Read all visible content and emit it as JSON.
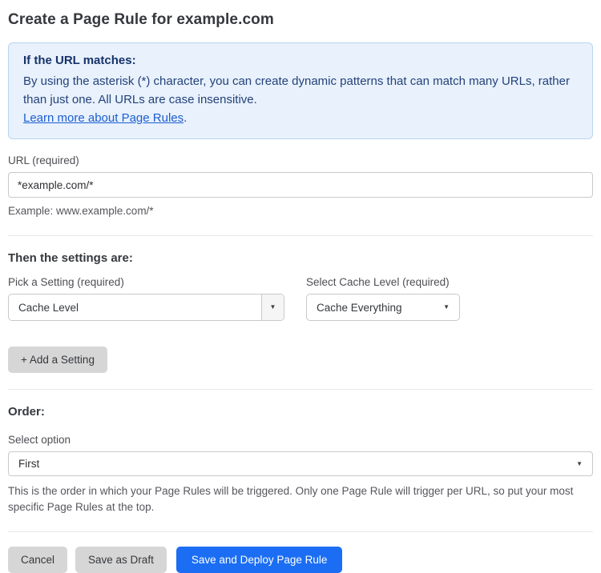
{
  "page": {
    "title": "Create a Page Rule for example.com"
  },
  "info_box": {
    "heading": "If the URL matches:",
    "body": "By using the asterisk (*) character, you can create dynamic patterns that can match many URLs, rather than just one. All URLs are case insensitive.",
    "link_label": "Learn more about Page Rules",
    "link_suffix": "."
  },
  "url_field": {
    "label": "URL (required)",
    "value": "*example.com/*",
    "helper": "Example: www.example.com/*"
  },
  "settings_section": {
    "heading": "Then the settings are:",
    "setting_select": {
      "label": "Pick a Setting (required)",
      "value": "Cache Level"
    },
    "cache_level_select": {
      "label": "Select Cache Level (required)",
      "value": "Cache Everything"
    },
    "add_button_label": "+ Add a Setting"
  },
  "order_section": {
    "heading": "Order:",
    "label": "Select option",
    "value": "First",
    "helper": "This is the order in which your Page Rules will be triggered. Only one Page Rule will trigger per URL, so put your most specific Page Rules at the top."
  },
  "actions": {
    "cancel_label": "Cancel",
    "save_draft_label": "Save as Draft",
    "save_deploy_label": "Save and Deploy Page Rule"
  },
  "icons": {
    "dropdown_arrow": "▼"
  },
  "colors": {
    "primary_blue": "#1b6ef3",
    "info_background": "#e8f1fc",
    "info_border": "#b9d4f1",
    "info_text": "#24427a",
    "link_blue": "#1b5ed2",
    "button_gray": "#d6d6d6",
    "border_gray": "#c9c9cc"
  }
}
